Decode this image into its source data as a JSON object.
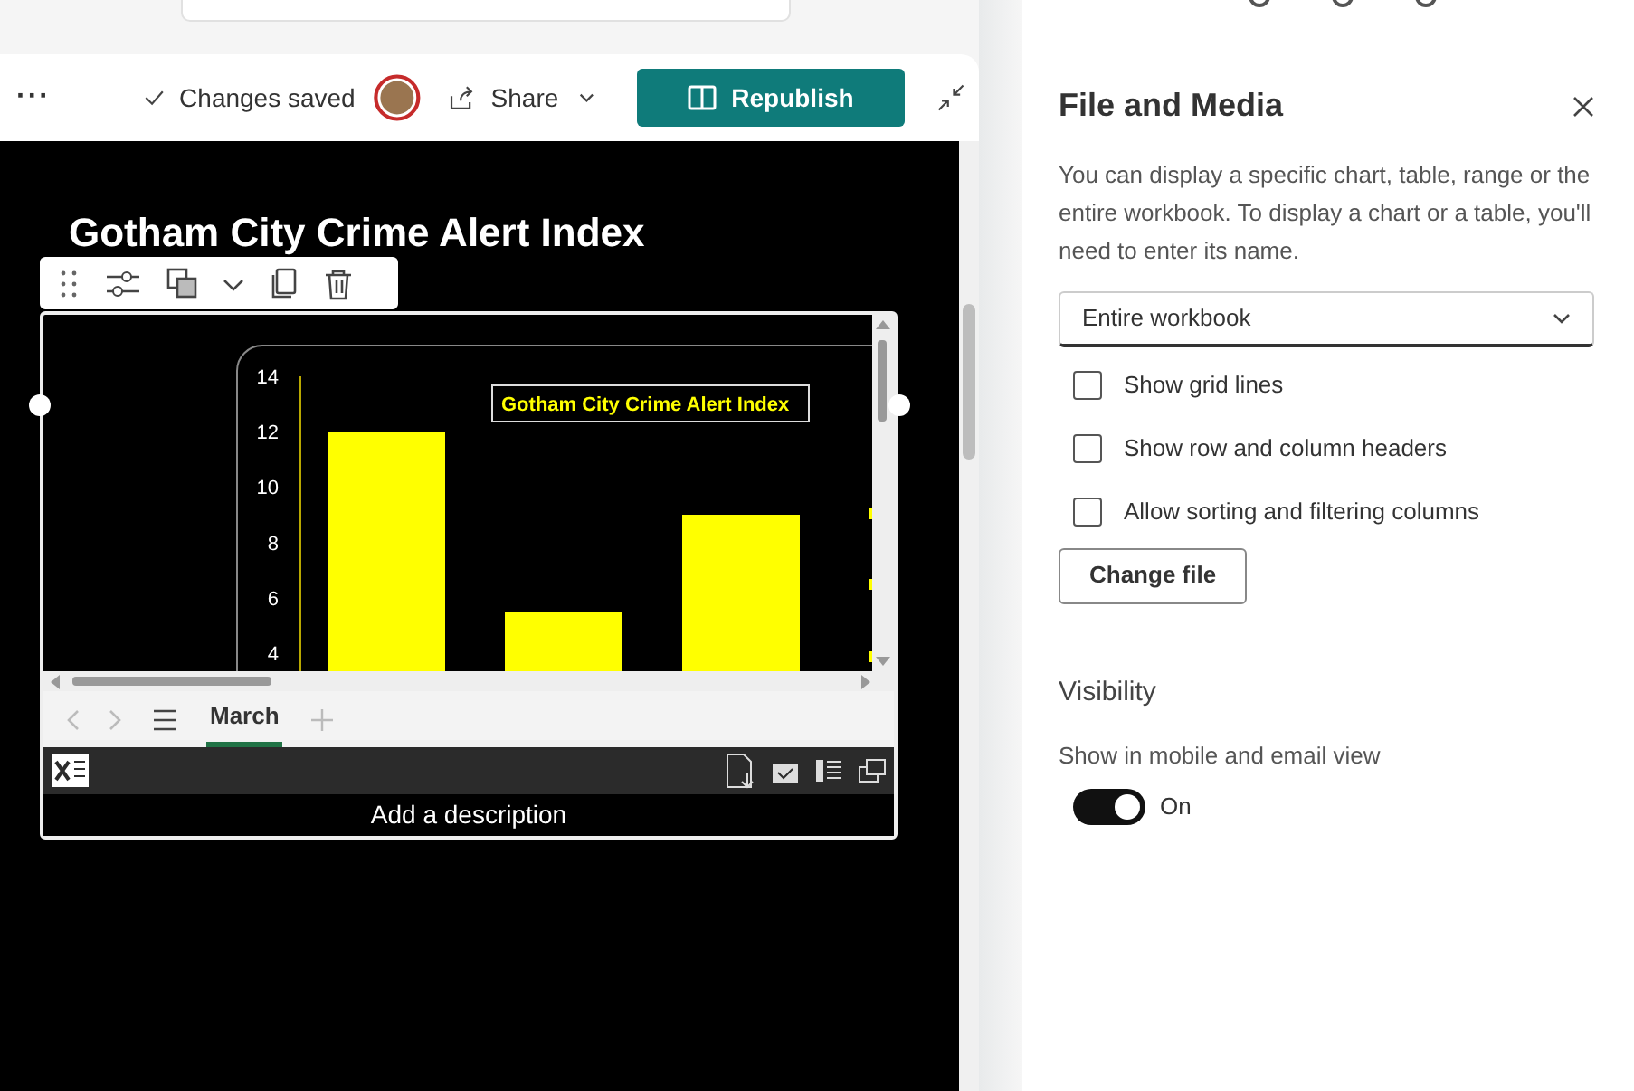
{
  "toolbar": {
    "more": "···",
    "status": "Changes saved",
    "share": "Share",
    "publish": "Republish"
  },
  "page": {
    "title": "Gotham City Crime Alert Index"
  },
  "embed": {
    "chart": {
      "title": "Gotham City Crime Alert Index",
      "axis_labels": [
        "14",
        "12",
        "10",
        "8",
        "6",
        "4"
      ]
    },
    "sheet_tabs": [
      {
        "label": "March",
        "selected": true
      }
    ],
    "description_placeholder": "Add a description"
  },
  "panel": {
    "title": "File and Media",
    "help": "You can display a specific chart, table, range or the entire workbook. To display a chart or a table, you'll need to enter its name.",
    "select": "Entire workbook",
    "options": [
      {
        "label": "Show grid lines",
        "checked": false
      },
      {
        "label": "Show row and column headers",
        "checked": false
      },
      {
        "label": "Allow sorting and filtering columns",
        "checked": false
      }
    ],
    "change_button": "Change file",
    "visibility": {
      "heading": "Visibility",
      "label": "Show in mobile and email view",
      "on": true,
      "state": "On"
    }
  }
}
